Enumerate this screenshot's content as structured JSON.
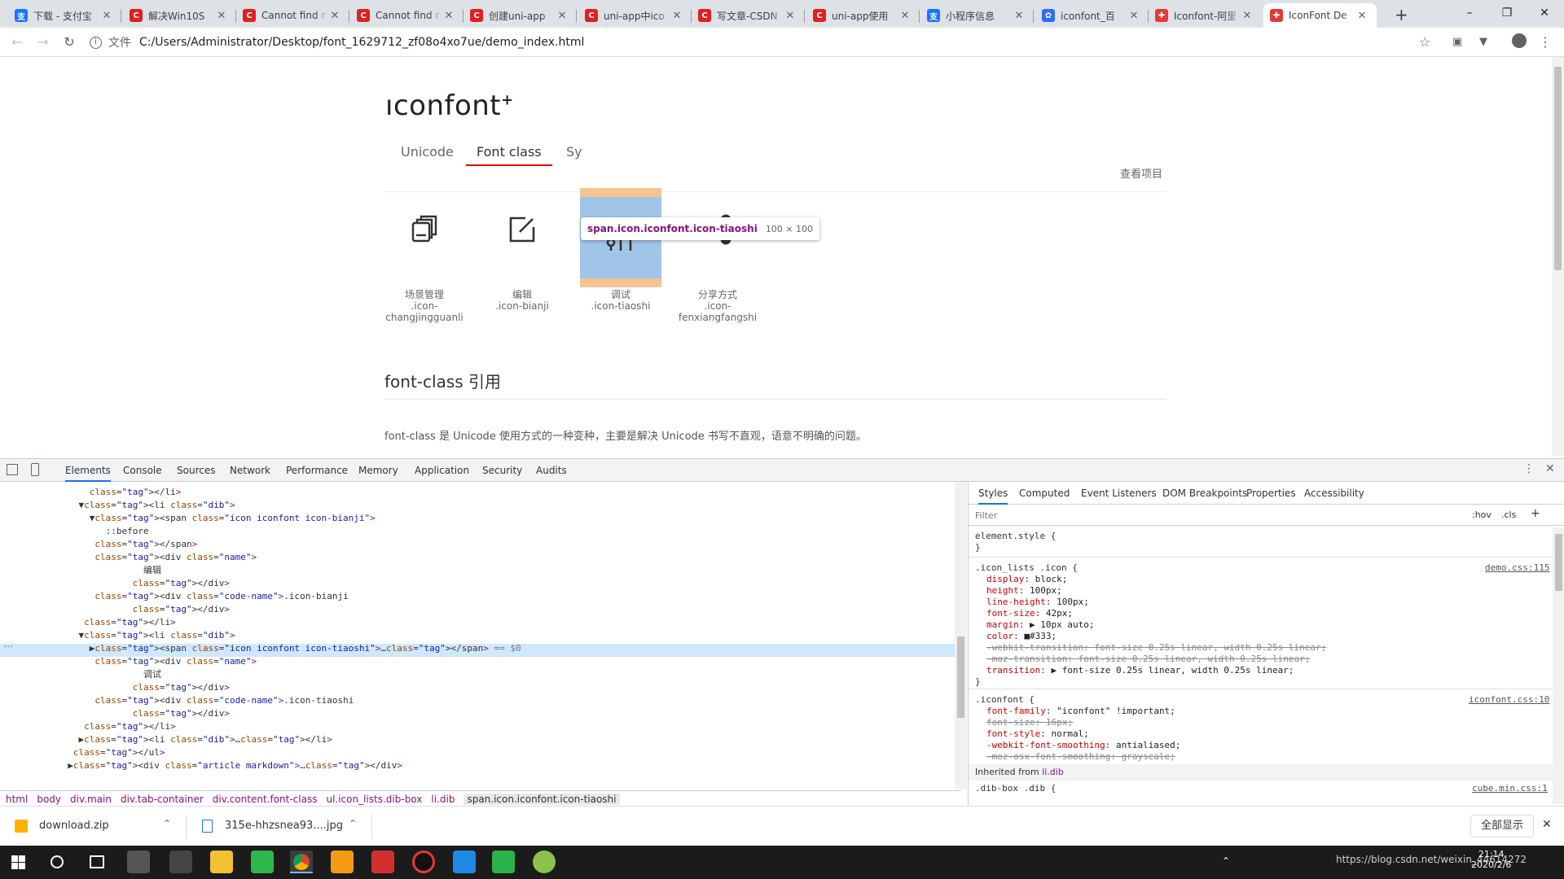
{
  "browser": {
    "tabs": [
      {
        "title": "下载 - 支付宝",
        "fav": "支",
        "color": "#1677ff"
      },
      {
        "title": "解决Win10S",
        "fav": "C",
        "color": "#e02020"
      },
      {
        "title": "Cannot find r",
        "fav": "C",
        "color": "#e02020"
      },
      {
        "title": "Cannot find r",
        "fav": "C",
        "color": "#e02020"
      },
      {
        "title": "创建uni-app",
        "fav": "C",
        "color": "#e02020"
      },
      {
        "title": "uni-app中ico",
        "fav": "C",
        "color": "#e02020"
      },
      {
        "title": "写文章-CSDN",
        "fav": "C",
        "color": "#e02020"
      },
      {
        "title": "uni-app使用",
        "fav": "C",
        "color": "#e02020"
      },
      {
        "title": "小程序信息",
        "fav": "支",
        "color": "#1677ff"
      },
      {
        "title": "iconfont_百",
        "fav": "✿",
        "color": "#2f6bff"
      },
      {
        "title": "Iconfont-阿里",
        "fav": "✚",
        "color": "#e53935"
      },
      {
        "title": "IconFont De",
        "fav": "✚",
        "color": "#e53935"
      }
    ],
    "address_prefix": "文件",
    "address": "C:/Users/Administrator/Desktop/font_1629712_zf08o4xo7ue/demo_index.html"
  },
  "page": {
    "logo": "ıconfont",
    "logo_plus": "+",
    "nav_tabs": [
      "Unicode",
      "Font class",
      "Sy"
    ],
    "view_project": "查看项目",
    "icons": [
      {
        "name": "场景管理",
        "code1": ".icon-",
        "code2": "changjingguanli",
        "icon": "layers-icon"
      },
      {
        "name": "编辑",
        "code1": ".icon-bianji",
        "code2": "",
        "icon": "edit-icon"
      },
      {
        "name": "调试",
        "code1": ".icon-tiaoshi",
        "code2": "",
        "icon": "sliders-icon"
      },
      {
        "name": "分享方式",
        "code1": ".icon-",
        "code2": "fenxiangfangshi",
        "icon": "share-icon"
      }
    ],
    "section_title": "font-class 引用",
    "section_text": "font-class 是 Unicode 使用方式的一种变种，主要是解决 Unicode 书写不直观，语意不明确的问题。",
    "tooltip_selector": "span.icon.iconfont.icon-tiaoshi",
    "tooltip_size": "100 × 100"
  },
  "devtools": {
    "tabs": [
      "Elements",
      "Console",
      "Sources",
      "Network",
      "Performance",
      "Memory",
      "Application",
      "Security",
      "Audits"
    ],
    "styles_tabs": [
      "Styles",
      "Computed",
      "Event Listeners",
      "DOM Breakpoints",
      "Properties",
      "Accessibility"
    ],
    "filter_placeholder": "Filter",
    "hov": ":hov",
    "cls": ".cls",
    "breadcrumbs": [
      "html",
      "body",
      "div.main",
      "div.tab-container",
      "div.content.font-class",
      "ul.icon_lists.dib-box",
      "li.dib",
      "span.icon.iconfont.icon-tiaoshi"
    ],
    "dom_lines": [
      "      </li>",
      "    ▼<li class=\"dib\">",
      "      ▼<span class=\"icon iconfont icon-bianji\">",
      "         ::before",
      "       </span>",
      "       <div class=\"name\">",
      "                编辑",
      "              </div>",
      "       <div class=\"code-name\">.icon-bianji",
      "              </div>",
      "     </li>",
      "    ▼<li class=\"dib\">",
      "      ▶<span class=\"icon iconfont icon-tiaoshi\">…</span> == $0",
      "       <div class=\"name\">",
      "                调试",
      "              </div>",
      "       <div class=\"code-name\">.icon-tiaoshi",
      "              </div>",
      "     </li>",
      "    ▶<li class=\"dib\">…</li>",
      "   </ul>",
      "  ▶<div class=\"article markdown\">…</div>"
    ],
    "element_style": "element.style {",
    "rule1_selector": ".icon_lists .icon {",
    "rule1_source": "demo.css:115",
    "rule1_props": [
      {
        "p": "display",
        "v": "block;"
      },
      {
        "p": "height",
        "v": "100px;"
      },
      {
        "p": "line-height",
        "v": "100px;"
      },
      {
        "p": "font-size",
        "v": "42px;"
      },
      {
        "p": "margin",
        "v": "▶ 10px auto;"
      },
      {
        "p": "color",
        "v": "■#333;"
      },
      {
        "p": "-webkit-transition",
        "v": "font-size 0.25s linear, width 0.25s linear;",
        "s": true
      },
      {
        "p": "-moz-transition",
        "v": "font-size 0.25s linear, width 0.25s linear;",
        "s": true
      },
      {
        "p": "transition",
        "v": "▶ font-size 0.25s linear, width 0.25s linear;"
      }
    ],
    "rule2_selector": ".iconfont {",
    "rule2_source": "iconfont.css:10",
    "rule2_props": [
      {
        "p": "font-family",
        "v": "\"iconfont\" !important;"
      },
      {
        "p": "font-size",
        "v": "16px;",
        "s": true
      },
      {
        "p": "font-style",
        "v": "normal;"
      },
      {
        "p": "-webkit-font-smoothing",
        "v": "antialiased;"
      },
      {
        "p": "-moz-osx-font-smoothing",
        "v": "grayscale;",
        "s": true
      }
    ],
    "inherited_label": "Inherited from",
    "inherited_from": "li.dib",
    "rule3_selector": ".dib-box .dib {",
    "rule3_source": "cube.min.css:1"
  },
  "downloads": {
    "items": [
      "download.zip",
      "315e-hhzsnea93....jpg"
    ],
    "show_all": "全部显示"
  },
  "taskbar": {
    "time": "21:14",
    "date": "2020/2/6",
    "watermark": "https://blog.csdn.net/weixin_44614272"
  }
}
